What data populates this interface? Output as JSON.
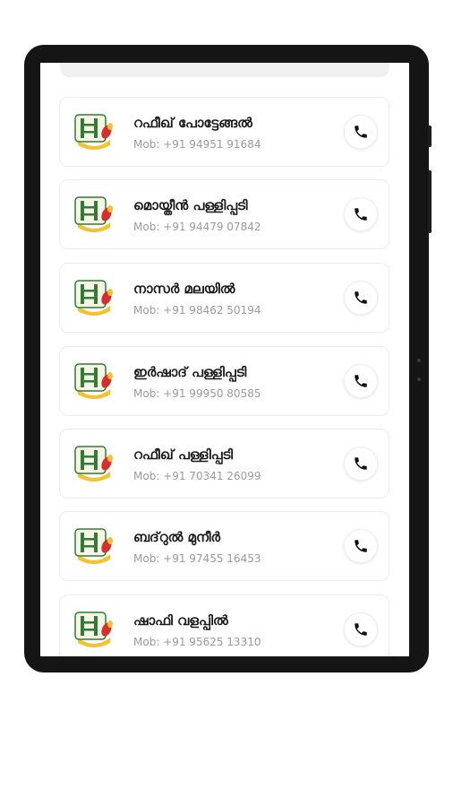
{
  "contacts": [
    {
      "name": "റഫീഖ് പോട്ടേങ്ങൽ",
      "mobile": "Mob: +91 94951 91684"
    },
    {
      "name": "മൊയ്തീൻ പള്ളിപ്പടി",
      "mobile": "Mob: +91 94479 07842"
    },
    {
      "name": "നാസർ മലയിൽ",
      "mobile": "Mob: +91 98462 50194"
    },
    {
      "name": "ഇർഷാദ് പള്ളിപ്പടി",
      "mobile": "Mob: +91 99950 80585"
    },
    {
      "name": "റഫീഖ് പള്ളിപ്പടി",
      "mobile": "Mob: +91 70341 26099"
    },
    {
      "name": "ബദ്‌റുൽ മുനീർ",
      "mobile": "Mob: +91 97455 16453"
    },
    {
      "name": "ഷാഫി വളപ്പിൽ",
      "mobile": "Mob: +91 95625 13310"
    }
  ],
  "icons": {
    "call": "phone-icon",
    "avatar": "ladder-symbol-icon"
  },
  "colors": {
    "device_frame": "#151515",
    "screen_bg": "#ffffff",
    "card_border": "#ededed",
    "name_text": "#1a1a1a",
    "mobile_text": "#9a9a9a",
    "avatar_yellow": "#f2c230",
    "avatar_red": "#d32f2f",
    "avatar_green": "#2e7d32"
  }
}
